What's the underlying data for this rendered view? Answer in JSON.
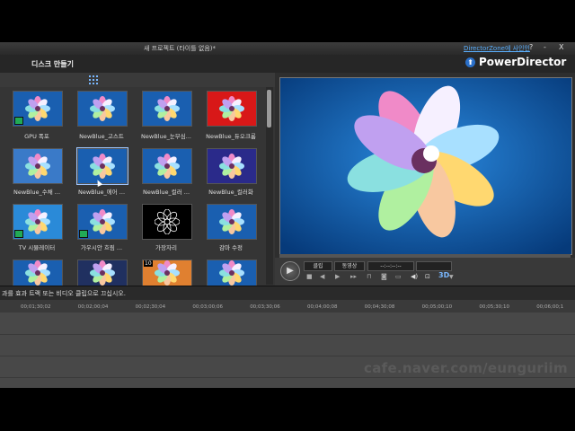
{
  "window": {
    "title": "새 프로젝트 (타이틀 없음)*",
    "signin_link": "DirectorZone에 사인인",
    "help": "?",
    "minimize": "-",
    "close": "X"
  },
  "modes": {
    "disc_tab": "디스크 만들기",
    "brand": "PowerDirector"
  },
  "library": {
    "items": [
      {
        "label": "GPU 폭포",
        "bg": "#1a5fb0",
        "badge": true,
        "sel": false,
        "num": ""
      },
      {
        "label": "NewBlue_고스트",
        "bg": "#1a5fb0",
        "badge": false,
        "sel": false,
        "num": ""
      },
      {
        "label": "NewBlue_눈부심...",
        "bg": "#1a5fb0",
        "badge": false,
        "sel": false,
        "num": ""
      },
      {
        "label": "NewBlue_듀오크롬",
        "bg": "#d81818",
        "badge": false,
        "sel": false,
        "num": ""
      },
      {
        "label": "NewBlue_수채 ...",
        "bg": "#3a7ac8",
        "badge": false,
        "sel": false,
        "num": ""
      },
      {
        "label": "NewBlue_에어 ...",
        "bg": "#1a5fb0",
        "badge": false,
        "sel": true,
        "num": ""
      },
      {
        "label": "NewBlue_컬러 ...",
        "bg": "#1a5fb0",
        "badge": false,
        "sel": false,
        "num": ""
      },
      {
        "label": "NewBlue_컬러화",
        "bg": "#2a2a8a",
        "badge": false,
        "sel": false,
        "num": ""
      },
      {
        "label": "TV 시뮬레이터",
        "bg": "#2a8ad8",
        "badge": true,
        "sel": false,
        "num": ""
      },
      {
        "label": "가우시안 흐림 ...",
        "bg": "#1a5fb0",
        "badge": true,
        "sel": false,
        "num": ""
      },
      {
        "label": "가장자리",
        "bg": "#000000",
        "badge": false,
        "sel": false,
        "num": ""
      },
      {
        "label": "감마 수정",
        "bg": "#1a5fb0",
        "badge": false,
        "sel": false,
        "num": ""
      },
      {
        "label": "",
        "bg": "#1a5fb0",
        "badge": false,
        "sel": false,
        "num": ""
      },
      {
        "label": "",
        "bg": "#203060",
        "badge": false,
        "sel": false,
        "num": ""
      },
      {
        "label": "",
        "bg": "#e08030",
        "badge": false,
        "sel": false,
        "num": "10"
      },
      {
        "label": "",
        "bg": "#1a5fb0",
        "badge": false,
        "sel": false,
        "num": ""
      }
    ]
  },
  "preview": {
    "clip_button": "클립",
    "movie_button": "동영상",
    "timecode": "--:--:--:--",
    "mode_3d": "3D"
  },
  "status": {
    "message": "과를 효과 트랙 또는 비디오 클립으로 끄십시오."
  },
  "timeline": {
    "ticks": [
      "00;01;30;02",
      "00;02;00;04",
      "00;02;30;04",
      "00;03;00;06",
      "00;03;30;06",
      "00;04;00;08",
      "00;04;30;08",
      "00;05;00;10",
      "00;05;30;10",
      "00;06;00;1"
    ]
  },
  "watermark": "cafe.naver.com/eunguriim"
}
